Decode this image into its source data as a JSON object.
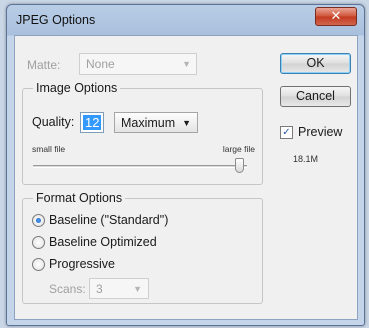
{
  "window": {
    "title": "JPEG Options",
    "close_glyph": "✕"
  },
  "matte": {
    "label": "Matte:",
    "value": "None"
  },
  "image_options": {
    "title": "Image Options",
    "quality_label": "Quality:",
    "quality_value": "12",
    "quality_preset": "Maximum",
    "small_file_label": "small file",
    "large_file_label": "large file",
    "slider_level_percent": 100
  },
  "format_options": {
    "title": "Format Options",
    "options": [
      {
        "label": "Baseline (\"Standard\")",
        "selected": true
      },
      {
        "label": "Baseline Optimized",
        "selected": false
      },
      {
        "label": "Progressive",
        "selected": false
      }
    ],
    "scans_label": "Scans:",
    "scans_value": "3"
  },
  "buttons": {
    "ok": "OK",
    "cancel": "Cancel"
  },
  "preview": {
    "label": "Preview",
    "checked": true,
    "file_size": "18.1M"
  }
}
